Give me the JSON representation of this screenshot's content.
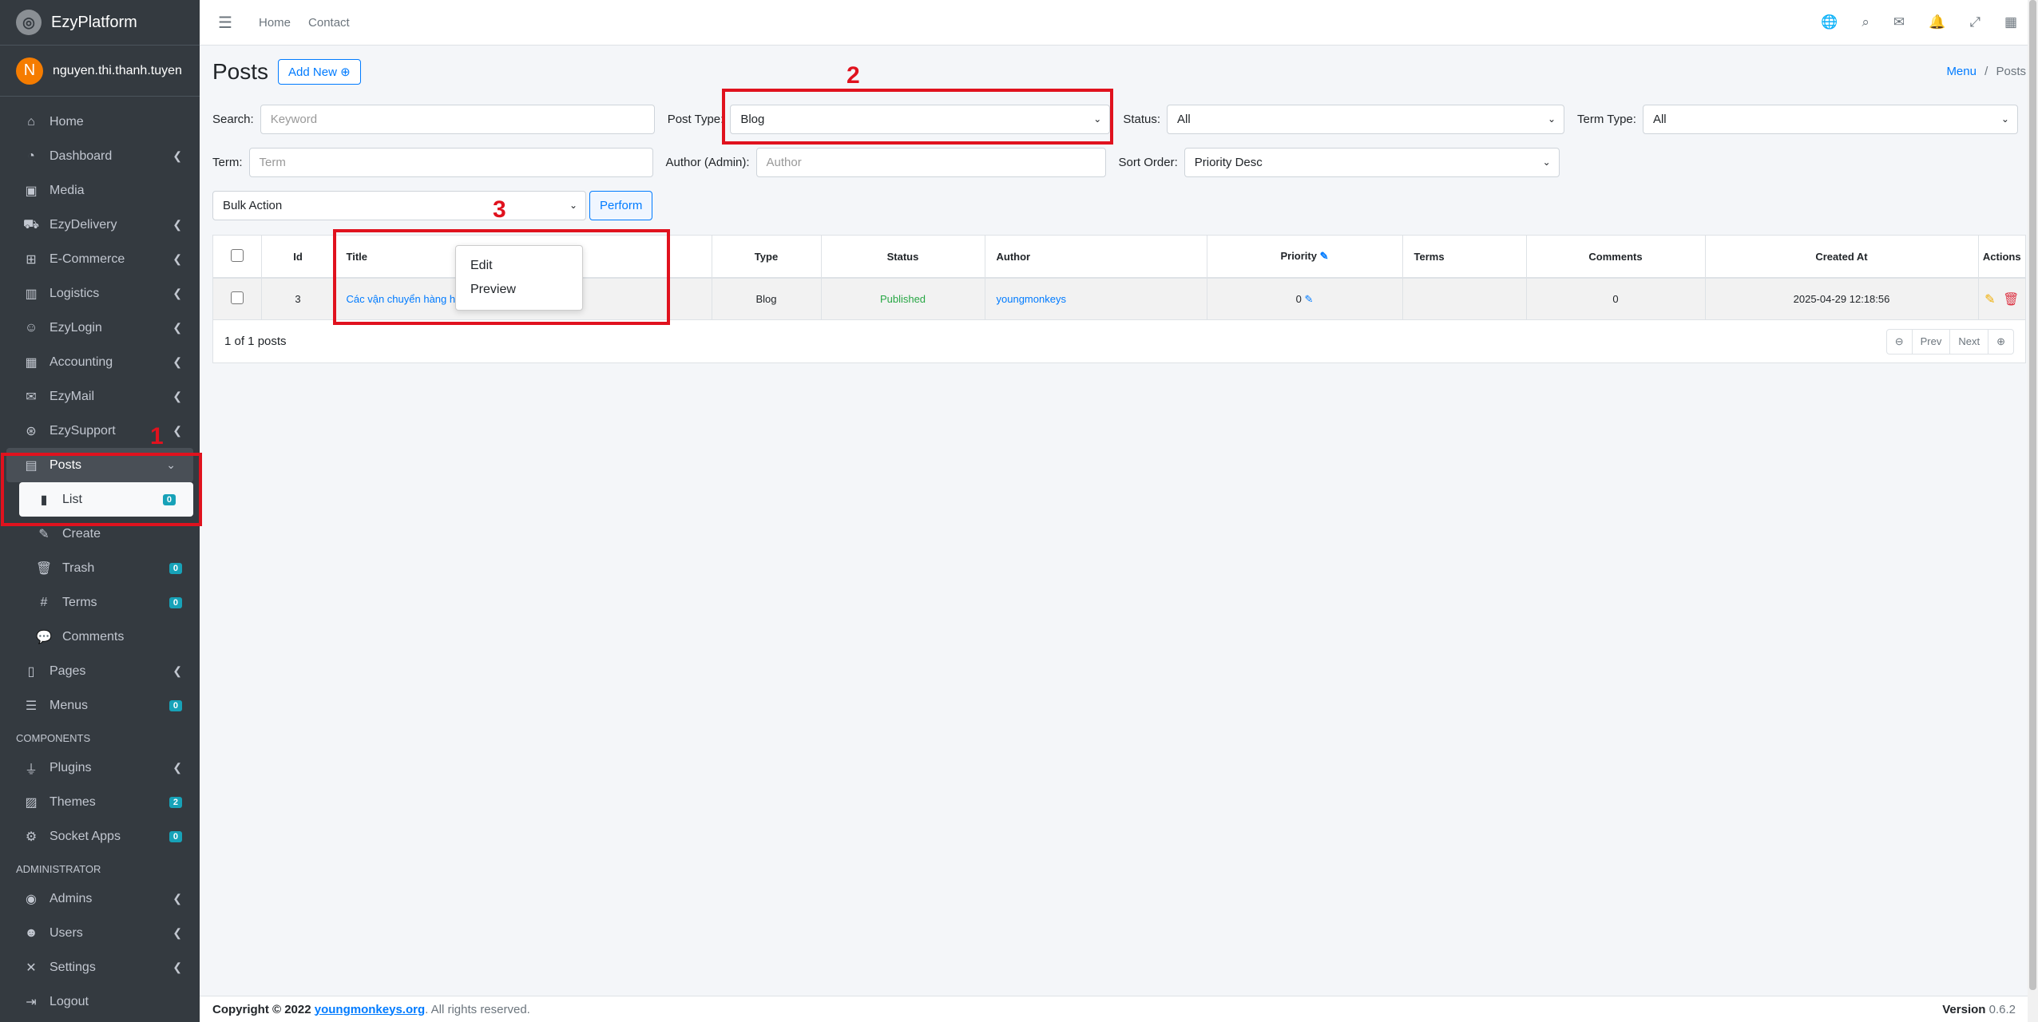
{
  "brand": {
    "name": "EzyPlatform"
  },
  "user": {
    "initial": "N",
    "name": "nguyen.thi.thanh.tuyen"
  },
  "sidebar": {
    "items": [
      {
        "label": "Home"
      },
      {
        "label": "Dashboard"
      },
      {
        "label": "Media"
      },
      {
        "label": "EzyDelivery"
      },
      {
        "label": "E-Commerce"
      },
      {
        "label": "Logistics"
      },
      {
        "label": "EzyLogin"
      },
      {
        "label": "Accounting"
      },
      {
        "label": "EzyMail"
      },
      {
        "label": "EzySupport"
      },
      {
        "label": "Posts"
      }
    ],
    "posts_sub": [
      {
        "label": "List",
        "badge": "0"
      },
      {
        "label": "Create"
      },
      {
        "label": "Trash",
        "badge": "0"
      },
      {
        "label": "Terms",
        "badge": "0"
      },
      {
        "label": "Comments"
      }
    ],
    "pages": {
      "label": "Pages"
    },
    "menus": {
      "label": "Menus",
      "badge": "0"
    },
    "components_header": "COMPONENTS",
    "plugins": {
      "label": "Plugins"
    },
    "themes": {
      "label": "Themes",
      "badge": "2"
    },
    "socket_apps": {
      "label": "Socket Apps",
      "badge": "0"
    },
    "admin_header": "ADMINISTRATOR",
    "admins": {
      "label": "Admins"
    },
    "users": {
      "label": "Users"
    },
    "settings": {
      "label": "Settings"
    },
    "logout": {
      "label": "Logout"
    }
  },
  "topbar": {
    "home": "Home",
    "contact": "Contact"
  },
  "page": {
    "title": "Posts",
    "add_new": "Add New",
    "breadcrumb_menu": "Menu",
    "breadcrumb_sep": "/",
    "breadcrumb_current": "Posts"
  },
  "filters": {
    "search_label": "Search:",
    "search_placeholder": "Keyword",
    "post_type_label": "Post Type:",
    "post_type_value": "Blog",
    "status_label": "Status:",
    "status_value": "All",
    "term_type_label": "Term Type:",
    "term_type_value": "All",
    "term_label": "Term:",
    "term_placeholder": "Term",
    "author_label": "Author (Admin):",
    "author_placeholder": "Author",
    "sort_label": "Sort Order:",
    "sort_value": "Priority Desc",
    "bulk_action": "Bulk Action",
    "perform": "Perform"
  },
  "table": {
    "headers": {
      "id": "Id",
      "title": "Title",
      "type": "Type",
      "status": "Status",
      "author": "Author",
      "priority": "Priority",
      "terms": "Terms",
      "comments": "Comments",
      "created_at": "Created At",
      "actions": "Actions"
    },
    "row": {
      "id": "3",
      "title": "Các vận chuyển hàng hoá",
      "type": "Blog",
      "status": "Published",
      "author": "youngmonkeys",
      "priority": "0",
      "terms": "",
      "comments": "0",
      "created_at": "2025-04-29 12:18:56"
    },
    "summary": "1 of 1 posts",
    "prev": "Prev",
    "next": "Next"
  },
  "context_menu": {
    "edit": "Edit",
    "preview": "Preview"
  },
  "annotations": {
    "one": "1",
    "two": "2",
    "three": "3"
  },
  "footer": {
    "copyright": "Copyright © 2022",
    "site": "youngmonkeys.org",
    "rights": ". All rights reserved.",
    "version_label": "Version",
    "version": "0.6.2"
  },
  "colors": {
    "sidebar": "#343a40",
    "accent": "#007bff",
    "annotation": "#e0121e",
    "published": "#28a745"
  }
}
